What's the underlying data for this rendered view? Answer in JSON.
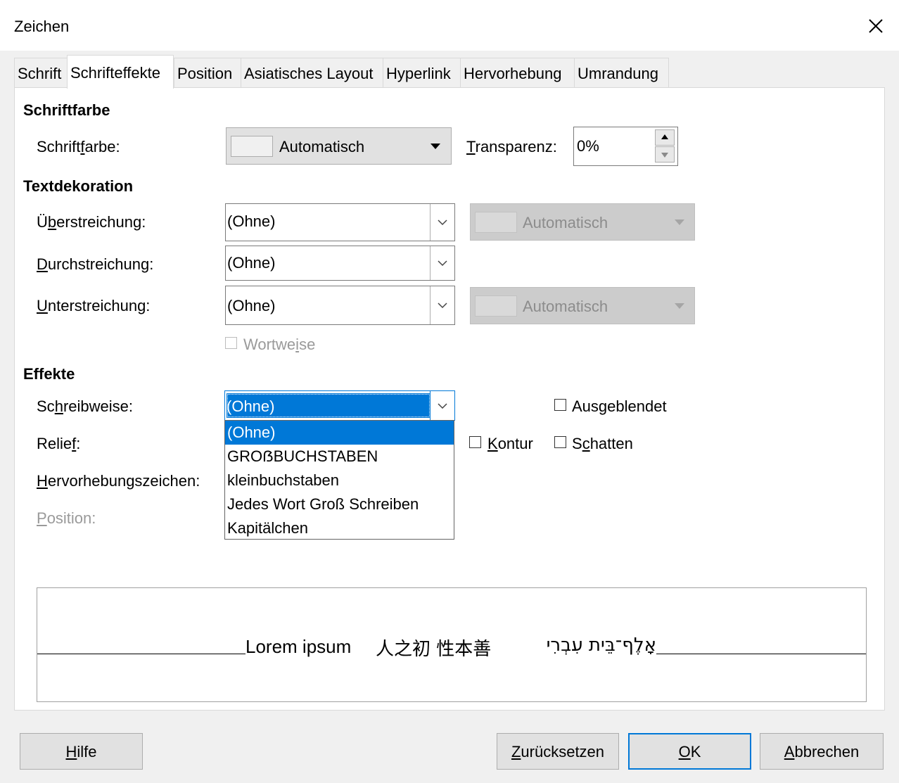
{
  "window": {
    "title": "Zeichen"
  },
  "tabs": [
    {
      "label": "Schrift"
    },
    {
      "label": "Schrifteffekte"
    },
    {
      "label": "Position"
    },
    {
      "label": "Asiatisches Layout"
    },
    {
      "label": "Hyperlink"
    },
    {
      "label": "Hervorhebung"
    },
    {
      "label": "Umrandung"
    }
  ],
  "font_color": {
    "section_title": "Schriftfarbe",
    "label_pre": "Schrift",
    "label_key": "f",
    "label_post": "arbe:",
    "value": "Automatisch",
    "transparency_label_key": "T",
    "transparency_label_post": "ransparenz:",
    "transparency_value": "0%"
  },
  "decoration": {
    "section_title": "Textdekoration",
    "overline_label_pre": "Ü",
    "overline_label_key": "b",
    "overline_label_post": "erstreichung:",
    "overline_value": "(Ohne)",
    "overline_color": "Automatisch",
    "strike_label_key": "D",
    "strike_label_post": "urchstreichung:",
    "strike_value": "(Ohne)",
    "underline_label_key": "U",
    "underline_label_post": "nterstreichung:",
    "underline_value": "(Ohne)",
    "underline_color": "Automatisch",
    "wordwise_pre": "Wortwe",
    "wordwise_key": "i",
    "wordwise_post": "se"
  },
  "effects": {
    "section_title": "Effekte",
    "case_label_pre": "Sc",
    "case_label_key": "h",
    "case_label_post": "reibweise:",
    "case_value": "(Ohne)",
    "case_options": [
      "(Ohne)",
      "GROẞBUCHSTABEN",
      "kleinbuchstaben",
      "Jedes Wort Groß Schreiben",
      "Kapitälchen"
    ],
    "relief_label_pre": "Relie",
    "relief_label_key": "f",
    "relief_label_post": ":",
    "emphasis_label_key": "H",
    "emphasis_label_post": "ervorhebungszeichen:",
    "position_label_key": "P",
    "position_label_post": "osition:",
    "hidden_pre": "Aus",
    "hidden_key": "g",
    "hidden_post": "eblendet",
    "outline_key": "K",
    "outline_post": "ontur",
    "shadow_pre": "S",
    "shadow_key": "c",
    "shadow_post": "hatten"
  },
  "preview": {
    "latin": "Lorem ipsum",
    "cjk": "人之初 性本善",
    "hebrew": "אָלֶף־בֵּית עִבְרִי"
  },
  "buttons": {
    "help_key": "H",
    "help_post": "ilfe",
    "reset_key": "Z",
    "reset_post": "urücksetzen",
    "ok_key": "O",
    "ok_post": "K",
    "cancel_key": "A",
    "cancel_post": "bbrechen"
  },
  "colors": {
    "selection": "#0078d7",
    "panel": "#ffffff",
    "dialog": "#f0f0f0"
  }
}
